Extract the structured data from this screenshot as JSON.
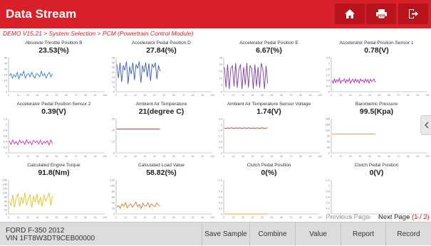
{
  "header": {
    "title": "Data Stream",
    "home_icon": "home-icon",
    "print_icon": "printer-icon",
    "exit_icon": "exit-icon",
    "accent": "#d8202a"
  },
  "breadcrumb": "DEMO V15.21 > System Selection > PCM (Powertrain Control Module)",
  "items": [
    {
      "name": "Absolute Throttle Position B",
      "value": "23.53(%)",
      "color": "#2f7fd6",
      "chart_data": {
        "type": "line",
        "ylim": [
          0,
          30
        ],
        "yticks": [
          "30",
          "25",
          "20",
          "15",
          "10",
          "5",
          "0"
        ],
        "values": [
          14,
          16,
          12,
          15,
          13,
          17,
          11,
          16,
          14,
          18,
          12,
          15,
          16,
          13,
          17,
          14,
          12,
          16,
          15,
          13,
          18,
          14,
          16,
          12,
          15,
          17,
          13,
          16
        ]
      }
    },
    {
      "name": "Accelerator Pedal Position D",
      "value": "27.84(%)",
      "color": "#3a58c8",
      "chart_data": {
        "type": "line",
        "ylim": [
          0,
          35
        ],
        "yticks": [
          "35",
          "30",
          "25",
          "20",
          "15",
          "10",
          "5",
          "0"
        ],
        "values": [
          28,
          14,
          30,
          10,
          27,
          22,
          31,
          8,
          26,
          18,
          30,
          12,
          28,
          24,
          31,
          9,
          27,
          20,
          30,
          15,
          29,
          11,
          28,
          25,
          30,
          13,
          27,
          21
        ]
      }
    },
    {
      "name": "Accelerator Pedal Position E",
      "value": "6.67(%)",
      "color": "#7d3da8",
      "chart_data": {
        "type": "line",
        "ylim": [
          0,
          25
        ],
        "yticks": [
          "25",
          "20",
          "15",
          "10",
          "5",
          "0"
        ],
        "values": [
          18,
          3,
          20,
          2,
          17,
          19,
          4,
          21,
          3,
          16,
          20,
          2,
          18,
          5,
          21,
          3,
          19,
          17,
          2,
          20,
          4,
          18,
          3,
          21,
          16,
          2,
          19,
          6
        ]
      }
    },
    {
      "name": "Accelerator Pedal Position Sensor 1",
      "value": "0.78(V)",
      "color": "#b42cb4",
      "chart_data": {
        "type": "line",
        "ylim": [
          0,
          2.4
        ],
        "yticks": [
          "2.4",
          "2",
          "1.6",
          "1.2",
          "0.8",
          "0.4",
          "0"
        ],
        "values": [
          0.8,
          0.6,
          0.9,
          0.65,
          0.85,
          0.7,
          0.95,
          0.6,
          0.8,
          0.75,
          0.9,
          0.62,
          0.85,
          0.7,
          0.92,
          0.6,
          0.8,
          0.88,
          0.65,
          0.9,
          0.7,
          0.84,
          0.6,
          0.9,
          0.75,
          0.82,
          0.64,
          0.9,
          0.7,
          0.85,
          0.6,
          0.88,
          0.72,
          0.8,
          0.9,
          0.65
        ]
      }
    },
    {
      "name": "Accelerator Pedal Position Sensor 2",
      "value": "0.39(V)",
      "color": "#d0309a",
      "chart_data": {
        "type": "line",
        "ylim": [
          0,
          1.2
        ],
        "yticks": [
          "1.2",
          "1",
          "0.8",
          "0.6",
          "0.4",
          "0.2",
          "0"
        ],
        "values": [
          0.42,
          0.3,
          0.45,
          0.32,
          0.4,
          0.28,
          0.44,
          0.35,
          0.41,
          0.3,
          0.46,
          0.33,
          0.4,
          0.29,
          0.44,
          0.36,
          0.42,
          0.31,
          0.45,
          0.3,
          0.4,
          0.34,
          0.43,
          0.28,
          0.45,
          0.32
        ]
      }
    },
    {
      "name": "Ambient Air Temperature",
      "value": "21(degree C)",
      "color": "#c21e1e",
      "chart_data": {
        "type": "line",
        "ylim": [
          0,
          30
        ],
        "yticks": [
          "30",
          "20",
          "10",
          "0"
        ],
        "values": [
          21,
          21,
          21,
          21,
          21,
          21,
          21,
          21,
          21,
          21,
          21,
          21,
          21,
          21,
          21,
          21,
          21,
          21,
          21,
          21,
          21,
          21,
          21,
          21,
          21,
          21
        ]
      }
    },
    {
      "name": "Ambient Air Temperature Sensor Voltage",
      "value": "1.74(V)",
      "color": "#e0301c",
      "chart_data": {
        "type": "line",
        "ylim": [
          0,
          2.4
        ],
        "yticks": [
          "2.4",
          "2",
          "1.6",
          "1.2",
          "0.8",
          "0.4",
          "0"
        ],
        "values": [
          1.74,
          1.72,
          1.75,
          1.73,
          1.76,
          1.72,
          1.74,
          1.75,
          1.73,
          1.76,
          1.72,
          1.74,
          1.75,
          1.73,
          1.76,
          1.72,
          1.74,
          1.75,
          1.73,
          1.76,
          1.72,
          1.74,
          1.75,
          1.73,
          1.74,
          1.76
        ]
      }
    },
    {
      "name": "Barometric Pressure",
      "value": "99.5(Kpa)",
      "color": "#f08a3a",
      "chart_data": {
        "type": "line",
        "ylim": [
          0,
          180
        ],
        "yticks": [
          "180",
          "150",
          "120",
          "90",
          "60",
          "30",
          "0"
        ],
        "values": [
          99.5,
          99.5,
          99.5,
          99.5,
          99.5,
          99.5,
          99.5,
          99.5,
          99.5,
          99.5,
          99.5,
          99.5,
          99.5,
          99.5,
          99.5,
          99.5,
          99.5,
          99.5,
          99.5,
          99.5,
          99.5,
          99.5,
          99.5,
          99.5,
          99.5,
          99.5
        ]
      }
    },
    {
      "name": "Calculated Engine Torque",
      "value": "91.8(Nm)",
      "color": "#e3c21a",
      "chart_data": {
        "type": "line",
        "ylim": [
          0,
          160
        ],
        "yticks": [
          "160",
          "140",
          "120",
          "100",
          "80",
          "60",
          "40",
          "20",
          "0"
        ],
        "values": [
          60,
          40,
          90,
          30,
          75,
          95,
          35,
          80,
          50,
          100,
          40,
          70,
          90,
          30,
          85,
          55,
          95,
          45,
          80,
          35,
          90,
          60,
          75,
          100,
          40,
          85
        ]
      }
    },
    {
      "name": "Calculated Load Value",
      "value": "58.82(%)",
      "color": "#d2782a",
      "chart_data": {
        "type": "line",
        "ylim": [
          0,
          120
        ],
        "yticks": [
          "120",
          "100",
          "80",
          "60",
          "40",
          "20",
          "0"
        ],
        "values": [
          25,
          30,
          20,
          35,
          28,
          40,
          22,
          30,
          36,
          24,
          32,
          42,
          26,
          34,
          20,
          38,
          30,
          28,
          40,
          24,
          36,
          30,
          26,
          38,
          32,
          28
        ]
      }
    },
    {
      "name": "Clutch Pedal Position",
      "value": "0(%)",
      "color": "#f0a030",
      "chart_data": {
        "type": "line",
        "ylim": [
          0,
          1.2
        ],
        "yticks": [
          "1.2",
          "1",
          "0.8",
          "0.6",
          "0.4",
          "0.2",
          "0"
        ],
        "values": [
          0,
          0,
          0,
          0,
          0,
          0,
          0,
          0,
          0,
          0,
          0,
          0,
          0,
          0,
          0,
          0,
          0,
          0,
          0,
          0,
          0,
          0,
          0,
          0,
          0,
          0
        ]
      }
    },
    {
      "name": "Clutch Pedal Position",
      "value": "0(V)",
      "color": "#f0a030",
      "chart_data": {
        "type": "line",
        "ylim": [
          0,
          1.2
        ],
        "yticks": [
          "1.2",
          "1",
          "0.8",
          "0.6",
          "0.4",
          "0.2",
          "0"
        ],
        "values": []
      }
    }
  ],
  "x_ticks": [
    "0",
    "10",
    "20",
    "30",
    "40",
    "50",
    "60",
    "70",
    "80",
    "90",
    "100"
  ],
  "pager": {
    "previous": "Previous Page",
    "next": "Next Page",
    "indicator": "(1 / 2)"
  },
  "vehicle": {
    "model": "FORD F-350 2012",
    "vin": "VIN 1FT8W3DT9CEB00000"
  },
  "footer_buttons": [
    "Save Sample",
    "Combine",
    "Value",
    "Report",
    "Record"
  ],
  "side_tab_icon": "chevron-left-icon"
}
